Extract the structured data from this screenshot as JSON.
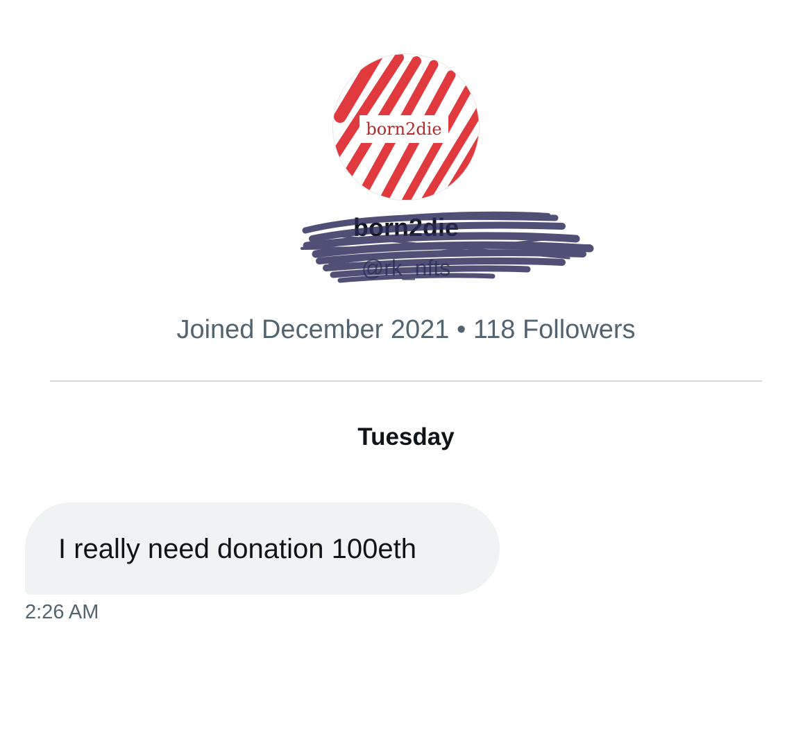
{
  "profile": {
    "avatar_text": "born2die",
    "display_name": "born2die",
    "handle": "@rk_nfts",
    "joined": "Joined December 2021",
    "separator": "•",
    "followers": "118 Followers"
  },
  "conversation": {
    "day_label": "Tuesday",
    "messages": [
      {
        "text": "I really need donation 100eth",
        "time": "2:26 AM"
      }
    ]
  },
  "colors": {
    "bubble": "#eff3f4",
    "muted_text": "#536471",
    "primary_text": "#0f1419",
    "divider": "#d6d9db",
    "avatar_stripes": "#e0393e",
    "scribble": "#2a2a5a"
  }
}
